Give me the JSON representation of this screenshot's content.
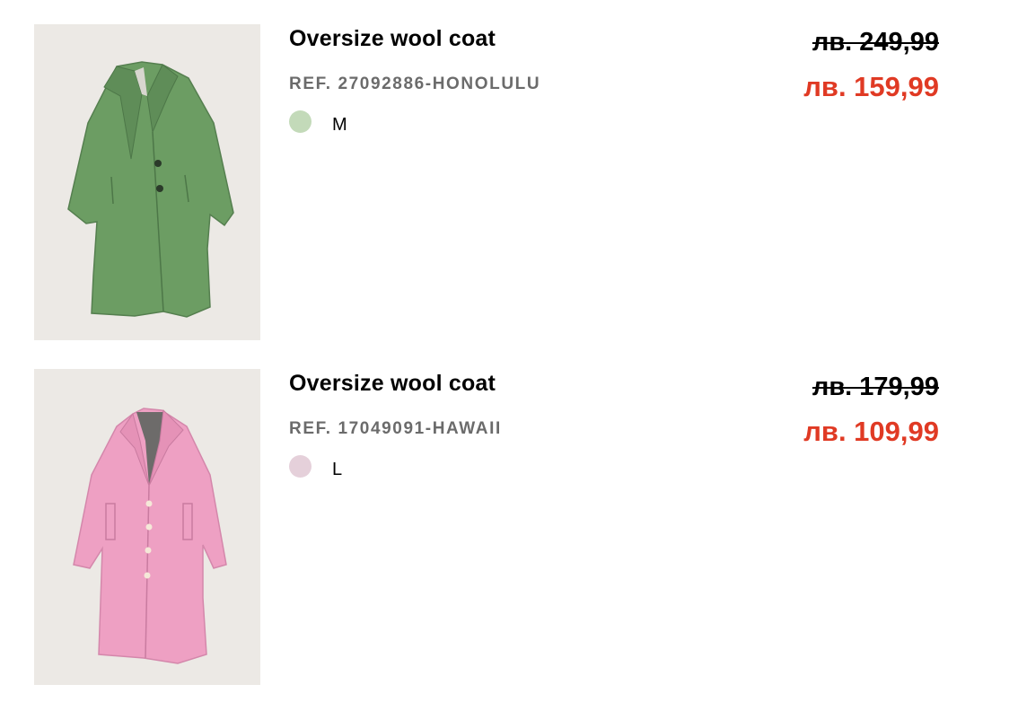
{
  "items": [
    {
      "name": "Oversize wool coat",
      "ref": "REF. 27092886-HONOLULU",
      "size": "M",
      "old_price": "лв. 249,99",
      "new_price": "лв. 159,99",
      "color_swatch": "#c3dab9",
      "image_icon": "green-coat-image"
    },
    {
      "name": "Oversize wool coat",
      "ref": "REF. 17049091-HAWAII",
      "size": "L",
      "old_price": "лв. 179,99",
      "new_price": "лв. 109,99",
      "color_swatch": "#e5d0da",
      "image_icon": "pink-coat-image"
    }
  ],
  "colors": {
    "sale_red": "#e03a24",
    "ref_gray": "#6b6b6b",
    "thumb_bg": "#ece9e5"
  }
}
